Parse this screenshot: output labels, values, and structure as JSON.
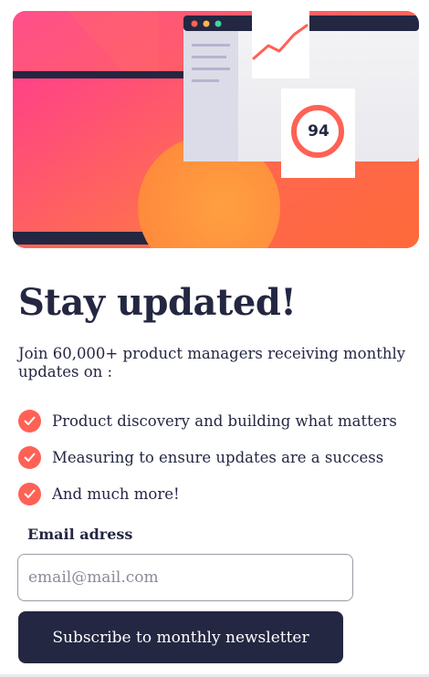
{
  "hero": {
    "score": "94",
    "colors": {
      "gradient_start": "#ff527b",
      "gradient_end": "#ff6a3a",
      "dark": "#242742"
    }
  },
  "content": {
    "title": "Stay updated!",
    "intro": "Join 60,000+ product managers receiving monthly updates on :",
    "features": [
      {
        "label": "Product discovery and building what matters",
        "icon": "check-icon"
      },
      {
        "label": "Measuring to ensure updates are a success",
        "icon": "check-icon"
      },
      {
        "label": "And much more!",
        "icon": "check-icon"
      }
    ]
  },
  "form": {
    "email_label": "Email adress",
    "email_placeholder": "email@mail.com",
    "email_value": "",
    "submit_label": "Subscribe to monthly newsletter"
  },
  "colors": {
    "accent": "#ff6155",
    "dark_navy": "#242742"
  }
}
